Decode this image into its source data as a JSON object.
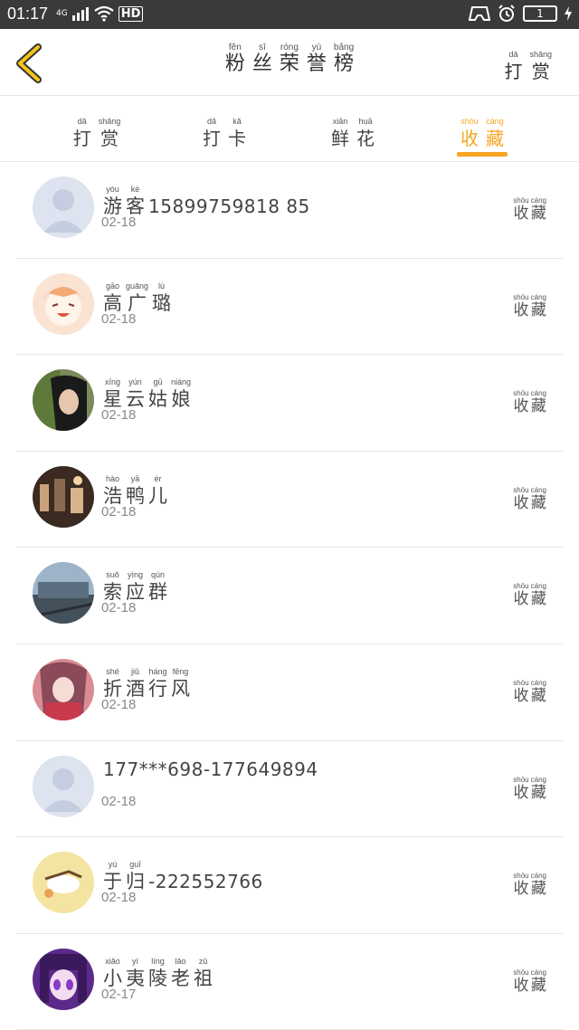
{
  "status_bar": {
    "time": "01:17",
    "network": "4G",
    "hd": "HD",
    "battery": "1"
  },
  "header": {
    "title": [
      {
        "py": "fěn",
        "hz": "粉"
      },
      {
        "py": "sī",
        "hz": "丝"
      },
      {
        "py": "róng",
        "hz": "荣"
      },
      {
        "py": "yù",
        "hz": "誉"
      },
      {
        "py": "bǎng",
        "hz": "榜"
      }
    ],
    "right": [
      {
        "py": "dǎ",
        "hz": "打"
      },
      {
        "py": "shǎng",
        "hz": "赏"
      }
    ]
  },
  "tabs": [
    {
      "chars": [
        {
          "py": "dǎ",
          "hz": "打"
        },
        {
          "py": "shǎng",
          "hz": "赏"
        }
      ],
      "active": false
    },
    {
      "chars": [
        {
          "py": "dǎ",
          "hz": "打"
        },
        {
          "py": "kǎ",
          "hz": "卡"
        }
      ],
      "active": false
    },
    {
      "chars": [
        {
          "py": "xiān",
          "hz": "鲜"
        },
        {
          "py": "huā",
          "hz": "花"
        }
      ],
      "active": false
    },
    {
      "chars": [
        {
          "py": "shōu",
          "hz": "收"
        },
        {
          "py": "cáng",
          "hz": "藏"
        }
      ],
      "active": true
    }
  ],
  "fav_label": [
    {
      "py": "shōu",
      "hz": "收"
    },
    {
      "py": "cáng",
      "hz": "藏"
    }
  ],
  "rows": [
    {
      "avatar": "default",
      "name": [
        {
          "py": "yóu",
          "hz": "游"
        },
        {
          "py": "kè",
          "hz": "客"
        }
      ],
      "suffix": "15899759818 85",
      "date": "02-18"
    },
    {
      "avatar": "anime-orange",
      "name": [
        {
          "py": "gāo",
          "hz": "高"
        },
        {
          "py": "guǎng",
          "hz": "广"
        },
        {
          "py": "lù",
          "hz": "璐"
        }
      ],
      "suffix": "",
      "date": "02-18"
    },
    {
      "avatar": "photo-boy",
      "name": [
        {
          "py": "xīng",
          "hz": "星"
        },
        {
          "py": "yún",
          "hz": "云"
        },
        {
          "py": "gū",
          "hz": "姑"
        },
        {
          "py": "niáng",
          "hz": "娘"
        }
      ],
      "suffix": "",
      "date": "02-18"
    },
    {
      "avatar": "photo-dark",
      "name": [
        {
          "py": "hào",
          "hz": "浩"
        },
        {
          "py": "yā",
          "hz": "鸭"
        },
        {
          "py": "ér",
          "hz": "儿"
        }
      ],
      "suffix": "",
      "date": "02-18"
    },
    {
      "avatar": "photo-train",
      "name": [
        {
          "py": "suǒ",
          "hz": "索"
        },
        {
          "py": "yìng",
          "hz": "应"
        },
        {
          "py": "qún",
          "hz": "群"
        }
      ],
      "suffix": "",
      "date": "02-18"
    },
    {
      "avatar": "anime-pink",
      "name": [
        {
          "py": "shé",
          "hz": "折"
        },
        {
          "py": "jiǔ",
          "hz": "酒"
        },
        {
          "py": "háng",
          "hz": "行"
        },
        {
          "py": "fēng",
          "hz": "风"
        }
      ],
      "suffix": "",
      "date": "02-18"
    },
    {
      "avatar": "default",
      "name": [],
      "suffix": "177***698-177649894",
      "date": "02-18"
    },
    {
      "avatar": "cartoon-yellow",
      "name": [
        {
          "py": "yú",
          "hz": "于"
        },
        {
          "py": "guī",
          "hz": "归"
        }
      ],
      "suffix": "-222552766",
      "date": "02-18"
    },
    {
      "avatar": "anime-purple",
      "name": [
        {
          "py": "xiǎo",
          "hz": "小"
        },
        {
          "py": "yí",
          "hz": "夷"
        },
        {
          "py": "líng",
          "hz": "陵"
        },
        {
          "py": "lǎo",
          "hz": "老"
        },
        {
          "py": "zǔ",
          "hz": "祖"
        }
      ],
      "suffix": "",
      "date": "02-17"
    }
  ],
  "colors": {
    "accent": "#f5a623",
    "statusbar": "#3a3a3a",
    "divider": "#e6e6e6",
    "back_arrow": "#f5c518"
  }
}
